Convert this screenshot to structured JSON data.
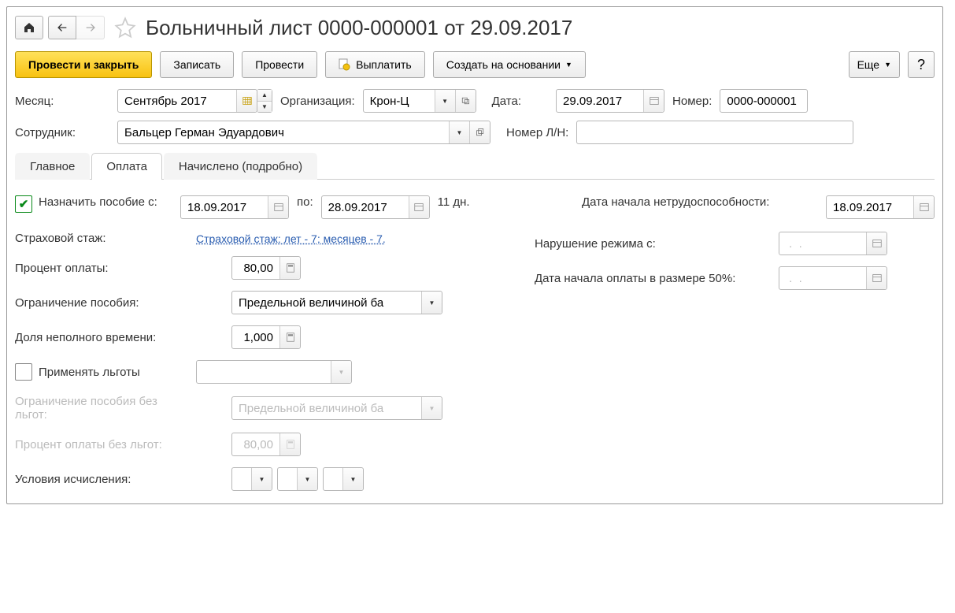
{
  "title": "Больничный лист 0000-000001 от 29.09.2017",
  "toolbar": {
    "post_close": "Провести и закрыть",
    "save": "Записать",
    "post": "Провести",
    "pay": "Выплатить",
    "create_based": "Создать на основании",
    "more": "Еще",
    "help": "?"
  },
  "header": {
    "month_label": "Месяц:",
    "month": "Сентябрь 2017",
    "org_label": "Организация:",
    "org": "Крон-Ц",
    "date_label": "Дата:",
    "date": "29.09.2017",
    "number_label": "Номер:",
    "number": "0000-000001",
    "employee_label": "Сотрудник:",
    "employee": "Бальцер Герман Эдуардович",
    "ln_label": "Номер Л/Н:",
    "ln": ""
  },
  "tabs": {
    "main": "Главное",
    "payment": "Оплата",
    "accrued": "Начислено (подробно)"
  },
  "payment": {
    "assign_label": "Назначить пособие с:",
    "assign_checked": true,
    "date_from": "18.09.2017",
    "to_label": "по:",
    "date_to": "28.09.2017",
    "days": "11 дн.",
    "stazh_label": "Страховой стаж:",
    "stazh_link": "Страховой стаж: лет - 7;  месяцев - 7.",
    "percent_label": "Процент оплаты:",
    "percent": "80,00",
    "limit_label": "Ограничение пособия:",
    "limit": "Предельной величиной ба",
    "share_label": "Доля неполного времени:",
    "share": "1,000",
    "benefits_label": "Применять льготы",
    "limit_no_ben_label": "Ограничение пособия без льгот:",
    "limit_no_ben": "Предельной величиной ба",
    "percent_no_ben_label": "Процент оплаты без льгот:",
    "percent_no_ben": "80,00",
    "conditions_label": "Условия исчисления:",
    "disability_start_label": "Дата начала нетрудоспособности:",
    "disability_start": "18.09.2017",
    "violation_label": "Нарушение режима с:",
    "violation": " .  .    ",
    "half_pay_label": "Дата начала оплаты в размере 50%:",
    "half_pay": " .  .    "
  }
}
